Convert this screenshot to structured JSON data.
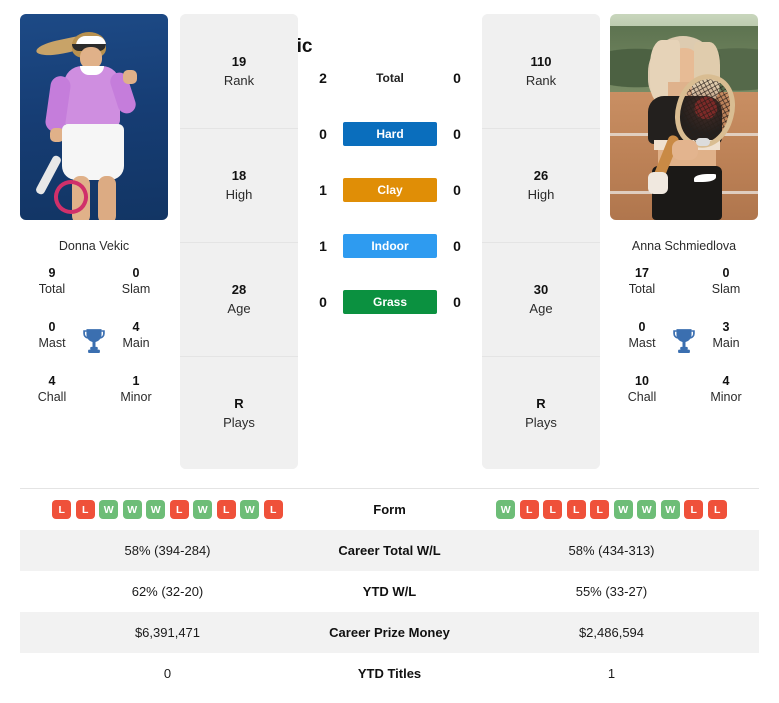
{
  "players": {
    "left": {
      "name": "Donna Vekic",
      "caption": "Donna Vekic",
      "flag": "croatia-flag",
      "rank": "19",
      "rank_label": "Rank",
      "high": "18",
      "high_label": "High",
      "age": "28",
      "age_label": "Age",
      "plays": "R",
      "plays_label": "Plays",
      "titles": {
        "total": "9",
        "total_label": "Total",
        "slam": "0",
        "slam_label": "Slam",
        "mast": "0",
        "mast_label": "Mast",
        "main": "4",
        "main_label": "Main",
        "chall": "4",
        "chall_label": "Chall",
        "minor": "1",
        "minor_label": "Minor"
      },
      "form": [
        "L",
        "L",
        "W",
        "W",
        "W",
        "L",
        "W",
        "L",
        "W",
        "L"
      ],
      "career_total_wl": "58% (394-284)",
      "ytd_wl": "62% (32-20)",
      "career_prize_money": "$6,391,471",
      "ytd_titles": "0"
    },
    "right": {
      "name": "Anna Schmiedlova",
      "caption": "Anna Schmiedlova",
      "flag": "slovakia-flag",
      "rank": "110",
      "rank_label": "Rank",
      "high": "26",
      "high_label": "High",
      "age": "30",
      "age_label": "Age",
      "plays": "R",
      "plays_label": "Plays",
      "titles": {
        "total": "17",
        "total_label": "Total",
        "slam": "0",
        "slam_label": "Slam",
        "mast": "0",
        "mast_label": "Mast",
        "main": "3",
        "main_label": "Main",
        "chall": "10",
        "chall_label": "Chall",
        "minor": "4",
        "minor_label": "Minor"
      },
      "form": [
        "W",
        "L",
        "L",
        "L",
        "L",
        "W",
        "W",
        "W",
        "L",
        "L"
      ],
      "career_total_wl": "58% (434-313)",
      "ytd_wl": "55% (33-27)",
      "career_prize_money": "$2,486,594",
      "ytd_titles": "1"
    }
  },
  "head_to_head": [
    {
      "label": "Total",
      "left": "2",
      "right": "0",
      "badge": false,
      "color": ""
    },
    {
      "label": "Hard",
      "left": "0",
      "right": "0",
      "badge": true,
      "color": "#0a6ebd"
    },
    {
      "label": "Clay",
      "left": "1",
      "right": "0",
      "badge": true,
      "color": "#e08e06"
    },
    {
      "label": "Indoor",
      "left": "1",
      "right": "0",
      "badge": true,
      "color": "#2e9bf0"
    },
    {
      "label": "Grass",
      "left": "0",
      "right": "0",
      "badge": true,
      "color": "#0b9140"
    }
  ],
  "table_rows": [
    {
      "label": "Form",
      "left": "",
      "right": "",
      "type": "form"
    },
    {
      "label": "Career Total W/L",
      "left": "58% (394-284)",
      "right": "58% (434-313)",
      "type": "text"
    },
    {
      "label": "YTD W/L",
      "left": "62% (32-20)",
      "right": "55% (33-27)",
      "type": "text"
    },
    {
      "label": "Career Prize Money",
      "left": "$6,391,471",
      "right": "$2,486,594",
      "type": "text"
    },
    {
      "label": "YTD Titles",
      "left": "0",
      "right": "1",
      "type": "text"
    }
  ],
  "colors": {
    "win": "#6dbd77",
    "loss": "#ef513a",
    "panel_bg": "#f0f0f0",
    "row_alt_bg": "#f2f2f2",
    "trophy": "#3b6fb0"
  },
  "icons": {
    "trophy": "trophy-icon"
  }
}
